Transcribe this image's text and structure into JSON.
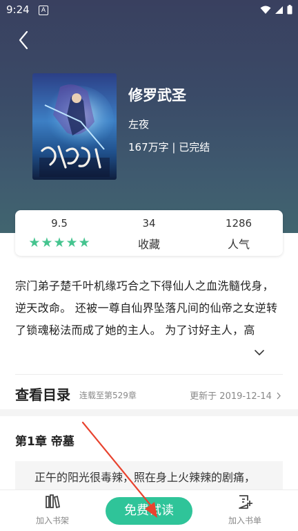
{
  "status_bar": {
    "time": "9:24",
    "notification_icon": "A"
  },
  "book": {
    "title": "修罗武圣",
    "author": "左夜",
    "meta": "167万字 | 已完结"
  },
  "stats": {
    "rating": "9.5",
    "stars": 5,
    "favorites_count": "34",
    "favorites_label": "收藏",
    "popularity_count": "1286",
    "popularity_label": "人气"
  },
  "synopsis": "宗门弟子楚千叶机缘巧合之下得仙人之血洗髓伐身，逆天改命。 还被一尊自仙界坠落凡间的仙帝之女逆转了锁魂秘法而成了她的主人。 为了讨好主人，高",
  "toc": {
    "title": "查看目录",
    "serial": "连载至第529章",
    "updated": "更新于 2019-12-14"
  },
  "chapter": {
    "title": "第1章 帝墓",
    "preview": "正午的阳光很毒辣，照在身上火辣辣的剧痛，"
  },
  "bottom_bar": {
    "add_shelf": "加入书架",
    "free_read": "免费试读",
    "add_list": "加入书单"
  },
  "colors": {
    "accent": "#2fc499",
    "star": "#45c48f",
    "annotation_arrow": "#e8432f"
  },
  "icons": [
    "back-arrow-icon",
    "wifi-icon",
    "signal-icon",
    "battery-icon",
    "chevron-down-icon",
    "chevron-right-icon",
    "bookshelf-icon",
    "add-booklist-icon",
    "star-icon"
  ]
}
